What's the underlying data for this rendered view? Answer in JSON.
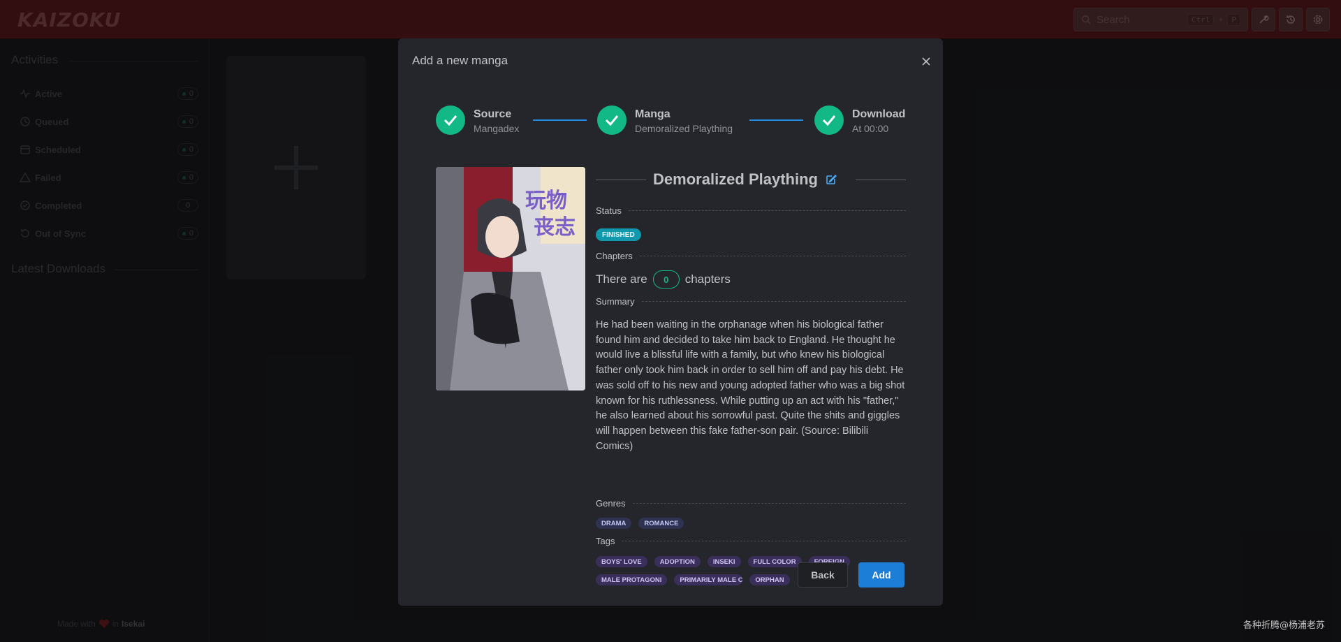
{
  "app": {
    "logo": "KAIZOKU"
  },
  "header": {
    "search_placeholder": "Search",
    "shortcut_key1": "Ctrl",
    "shortcut_plus": "+",
    "shortcut_key2": "P"
  },
  "sidebar": {
    "activities_title": "Activities",
    "activities": [
      {
        "label": "Active",
        "count": "0"
      },
      {
        "label": "Queued",
        "count": "0"
      },
      {
        "label": "Scheduled",
        "count": "0"
      },
      {
        "label": "Failed",
        "count": "0"
      },
      {
        "label": "Completed",
        "count": "0"
      },
      {
        "label": "Out of Sync",
        "count": "0"
      }
    ],
    "latest_title": "Latest Downloads",
    "made_with": "Made with",
    "made_in": "in",
    "made_place": "Isekai"
  },
  "modal": {
    "title": "Add a new manga",
    "steps": [
      {
        "label": "Source",
        "description": "Mangadex"
      },
      {
        "label": "Manga",
        "description": "Demoralized Plaything"
      },
      {
        "label": "Download",
        "description": "At 00:00"
      }
    ],
    "manga": {
      "title": "Demoralized Plaything",
      "status_label": "Status",
      "status": "FINISHED",
      "chapters_label": "Chapters",
      "chapters_prefix": "There are",
      "chapters_count": "0",
      "chapters_suffix": "chapters",
      "summary_label": "Summary",
      "summary": "He had been waiting in the orphanage when his biological father found him and decided to take him back to England. He thought he would live a blissful life with a family, but who knew his biological father only took him back in order to sell him off and pay his debt. He was sold off to his new and young adopted father who was a big shot known for his ruthlessness. While putting up an act with his \"father,\" he also learned about his sorrowful past. Quite the shits and giggles will happen between this fake father-son pair. (Source: Bilibili Comics)",
      "genres_label": "Genres",
      "genres": [
        "DRAMA",
        "ROMANCE"
      ],
      "tags_label": "Tags",
      "tags_row1": [
        "BOYS' LOVE",
        "ADOPTION",
        "INSEKI",
        "FULL COLOR",
        "FOREIGN"
      ],
      "tags_row2": [
        "MALE PROTAGONI",
        "PRIMARILY MALE C",
        "ORPHAN"
      ],
      "cover_text": "玩物丧志"
    },
    "back_label": "Back",
    "add_label": "Add"
  },
  "watermark": "各种折腾@杨浦老苏",
  "colors": {
    "accent_green": "#12b886",
    "accent_blue": "#1c7ed6",
    "header_red": "#5c1a1e"
  }
}
